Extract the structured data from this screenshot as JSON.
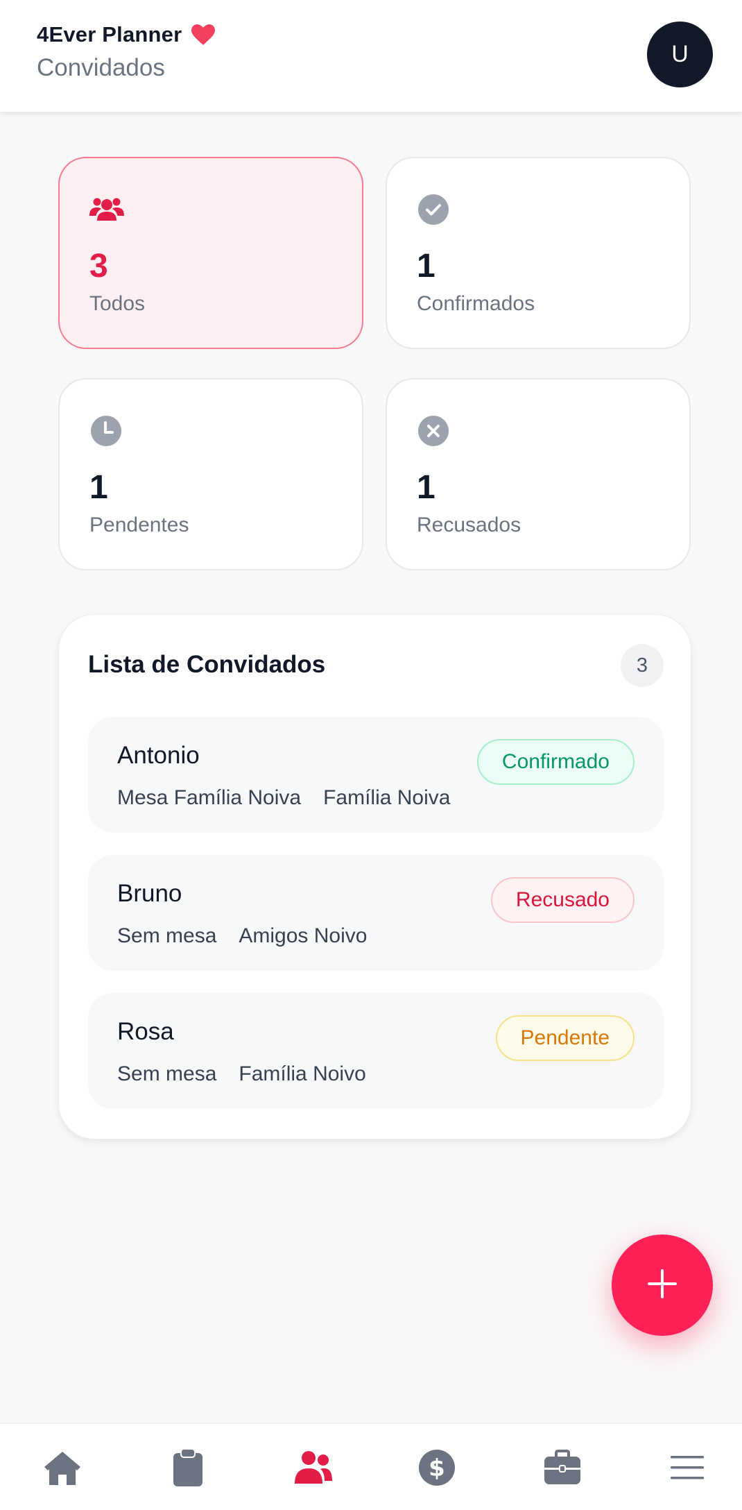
{
  "header": {
    "brand": "4Ever Planner",
    "page_title": "Convidados",
    "avatar_initial": "U"
  },
  "stats": [
    {
      "value": "3",
      "label": "Todos",
      "icon": "users-icon",
      "active": true
    },
    {
      "value": "1",
      "label": "Confirmados",
      "icon": "check-circle-icon",
      "active": false
    },
    {
      "value": "1",
      "label": "Pendentes",
      "icon": "clock-icon",
      "active": false
    },
    {
      "value": "1",
      "label": "Recusados",
      "icon": "x-circle-icon",
      "active": false
    }
  ],
  "list": {
    "title": "Lista de Convidados",
    "count": "3",
    "guests": [
      {
        "name": "Antonio",
        "table": "Mesa Família Noiva",
        "group": "Família Noiva",
        "status": "Confirmado"
      },
      {
        "name": "Bruno",
        "table": "Sem mesa",
        "group": "Amigos Noivo",
        "status": "Recusado"
      },
      {
        "name": "Rosa",
        "table": "Sem mesa",
        "group": "Família Noivo",
        "status": "Pendente"
      }
    ]
  },
  "nav": {
    "items": [
      {
        "icon": "home-icon",
        "active": false
      },
      {
        "icon": "clipboard-icon",
        "active": false
      },
      {
        "icon": "users-icon",
        "active": true
      },
      {
        "icon": "dollar-icon",
        "active": false
      },
      {
        "icon": "briefcase-icon",
        "active": false
      },
      {
        "icon": "menu-icon",
        "active": false
      }
    ]
  },
  "colors": {
    "accent": "#e11d48",
    "fab": "#ff2057",
    "confirmed": "#059669",
    "refused": "#dc143c",
    "pending": "#d97706",
    "icon_gray": "#9ca3af",
    "nav_gray": "#6b7280"
  }
}
